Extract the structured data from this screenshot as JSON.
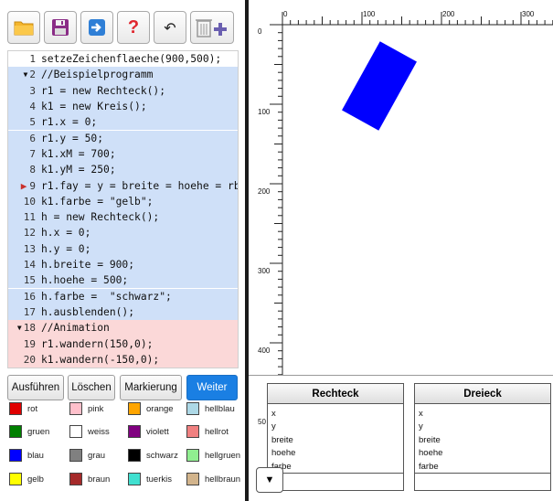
{
  "toolbar": {
    "open_icon": "folder-icon",
    "save_icon": "save-icon",
    "export_icon": "export-icon",
    "help_label": "?",
    "undo_label": "↶",
    "clear_icon": "trash-plus-icon"
  },
  "editor": {
    "lines": [
      {
        "num": "1",
        "code": "setzeZeichenflaeche(900,500);",
        "bg": "#ffffff",
        "fold": "",
        "active": false
      },
      {
        "num": "2",
        "code": "//Beispielprogramm",
        "bg": "#cfe0f8",
        "fold": "▼",
        "active": false
      },
      {
        "num": "3",
        "code": "r1 = new Rechteck();",
        "bg": "#cfe0f8",
        "fold": "",
        "active": false
      },
      {
        "num": "4",
        "code": "k1 = new Kreis();",
        "bg": "#cfe0f8",
        "fold": "",
        "active": false
      },
      {
        "num": "5",
        "code": "r1.x = 0;",
        "bg": "#cfe0f8",
        "fold": "",
        "active": false
      },
      {
        "num": "6",
        "code": "r1.y = 50;",
        "bg": "#cfe0f8",
        "fold": "",
        "active": false
      },
      {
        "num": "7",
        "code": "k1.xM = 700;",
        "bg": "#cfe0f8",
        "fold": "",
        "active": false
      },
      {
        "num": "8",
        "code": "k1.yM = 250;",
        "bg": "#cfe0f8",
        "fold": "",
        "active": false
      },
      {
        "num": "9",
        "code": "r1.fay = y = breite = hoehe = rb",
        "bg": "#cfe0f8",
        "fold": "",
        "active": true
      },
      {
        "num": "10",
        "code": "k1.farbe = \"gelb\";",
        "bg": "#cfe0f8",
        "fold": "",
        "active": false
      },
      {
        "num": "11",
        "code": "h = new Rechteck();",
        "bg": "#cfe0f8",
        "fold": "",
        "active": false
      },
      {
        "num": "12",
        "code": "h.x = 0;",
        "bg": "#cfe0f8",
        "fold": "",
        "active": false
      },
      {
        "num": "13",
        "code": "h.y = 0;",
        "bg": "#cfe0f8",
        "fold": "",
        "active": false
      },
      {
        "num": "14",
        "code": "h.breite = 900;",
        "bg": "#cfe0f8",
        "fold": "",
        "active": false
      },
      {
        "num": "15",
        "code": "h.hoehe = 500;",
        "bg": "#cfe0f8",
        "fold": "",
        "active": false
      },
      {
        "num": "16",
        "code": "h.farbe =  \"schwarz\";",
        "bg": "#cfe0f8",
        "fold": "",
        "active": false
      },
      {
        "num": "17",
        "code": "h.ausblenden();",
        "bg": "#cfe0f8",
        "fold": "",
        "active": false
      },
      {
        "num": "18",
        "code": "//Animation",
        "bg": "#fbd8d8",
        "fold": "▼",
        "active": false
      },
      {
        "num": "19",
        "code": "r1.wandern(150,0);",
        "bg": "#fbd8d8",
        "fold": "",
        "active": false
      },
      {
        "num": "20",
        "code": "k1.wandern(-150,0);",
        "bg": "#fbd8d8",
        "fold": "",
        "active": false
      }
    ]
  },
  "actions": {
    "run_label": "Ausführen",
    "delete_label": "Löschen",
    "mark_label": "Markierung",
    "next_label": "Weiter"
  },
  "colors": [
    {
      "name": "rot",
      "hex": "#e00000"
    },
    {
      "name": "pink",
      "hex": "#ffc0cb"
    },
    {
      "name": "orange",
      "hex": "#ffa500"
    },
    {
      "name": "hellblau",
      "hex": "#add8e6"
    },
    {
      "name": "gruen",
      "hex": "#008000"
    },
    {
      "name": "weiss",
      "hex": "#ffffff"
    },
    {
      "name": "violett",
      "hex": "#800080"
    },
    {
      "name": "hellrot",
      "hex": "#f08080"
    },
    {
      "name": "blau",
      "hex": "#0000ff"
    },
    {
      "name": "grau",
      "hex": "#808080"
    },
    {
      "name": "schwarz",
      "hex": "#000000"
    },
    {
      "name": "hellgruen",
      "hex": "#90ee90"
    },
    {
      "name": "gelb",
      "hex": "#ffff00"
    },
    {
      "name": "braun",
      "hex": "#a52a2a"
    },
    {
      "name": "tuerkis",
      "hex": "#40e0d0"
    },
    {
      "name": "hellbraun",
      "hex": "#d2b48c"
    }
  ],
  "canvas": {
    "x_ticks": [
      "0",
      "100",
      "200",
      "300"
    ],
    "y_ticks": [
      "0",
      "100",
      "200",
      "300",
      "400",
      "50"
    ],
    "shape_color": "#0000ff"
  },
  "classes": [
    {
      "title": "Rechteck",
      "attrs": [
        "x",
        "y",
        "breite",
        "hoehe",
        "farbe"
      ]
    },
    {
      "title": "Dreieck",
      "attrs": [
        "x",
        "y",
        "breite",
        "hoehe",
        "farbe"
      ]
    }
  ],
  "collapse_label": "▼"
}
